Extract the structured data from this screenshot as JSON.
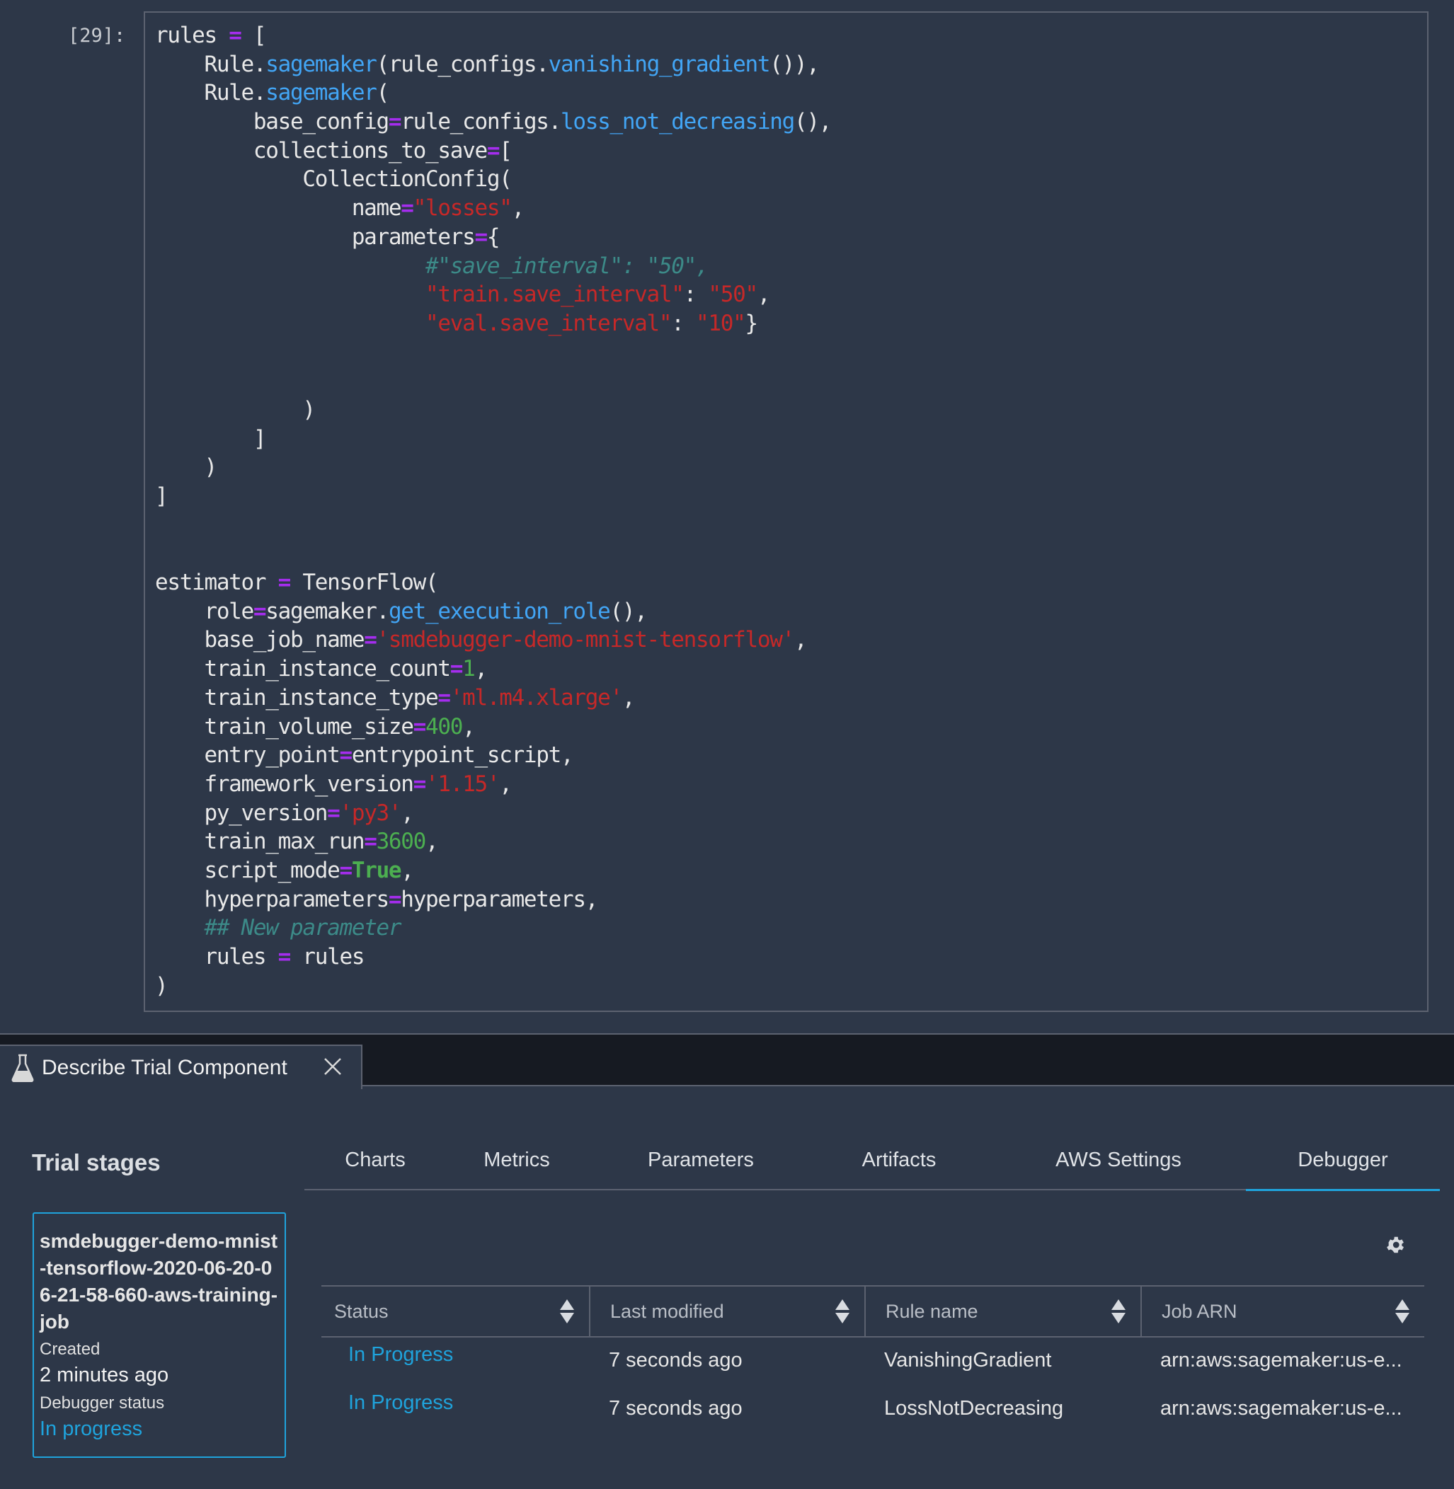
{
  "notebook": {
    "prompt": "[29]:",
    "code_lines": [
      [
        [
          "rules ",
          ""
        ],
        [
          "=",
          "op"
        ],
        [
          " [",
          ""
        ]
      ],
      [
        [
          "    Rule.",
          ""
        ],
        [
          "sagemaker",
          "fn"
        ],
        [
          "(rule_configs.",
          ""
        ],
        [
          "vanishing_gradient",
          "fn"
        ],
        [
          "()),",
          ""
        ]
      ],
      [
        [
          "    Rule.",
          ""
        ],
        [
          "sagemaker",
          "fn"
        ],
        [
          "(",
          ""
        ]
      ],
      [
        [
          "        base_config",
          ""
        ],
        [
          "=",
          "op"
        ],
        [
          "rule_configs.",
          ""
        ],
        [
          "loss_not_decreasing",
          "fn"
        ],
        [
          "(),",
          ""
        ]
      ],
      [
        [
          "        collections_to_save",
          ""
        ],
        [
          "=",
          "op"
        ],
        [
          "[",
          ""
        ]
      ],
      [
        [
          "            CollectionConfig(",
          ""
        ]
      ],
      [
        [
          "                name",
          ""
        ],
        [
          "=",
          "op"
        ],
        [
          "\"losses\"",
          "st"
        ],
        [
          ",",
          ""
        ]
      ],
      [
        [
          "                parameters",
          ""
        ],
        [
          "=",
          "op"
        ],
        [
          "{",
          ""
        ]
      ],
      [
        [
          "                      #\"save_interval\": \"50\",",
          "cm"
        ]
      ],
      [
        [
          "                      ",
          ""
        ],
        [
          "\"train.save_interval\"",
          "st"
        ],
        [
          ": ",
          ""
        ],
        [
          "\"50\"",
          "st"
        ],
        [
          ",",
          ""
        ]
      ],
      [
        [
          "                      ",
          ""
        ],
        [
          "\"eval.save_interval\"",
          "st"
        ],
        [
          ": ",
          ""
        ],
        [
          "\"10\"",
          "st"
        ],
        [
          "}",
          ""
        ]
      ],
      [
        [
          "",
          ""
        ]
      ],
      [
        [
          "",
          ""
        ]
      ],
      [
        [
          "            )",
          ""
        ]
      ],
      [
        [
          "        ]",
          ""
        ]
      ],
      [
        [
          "    )",
          ""
        ]
      ],
      [
        [
          "]",
          ""
        ]
      ],
      [
        [
          "",
          ""
        ]
      ],
      [
        [
          "",
          ""
        ]
      ],
      [
        [
          "estimator ",
          ""
        ],
        [
          "=",
          "op"
        ],
        [
          " TensorFlow(",
          ""
        ]
      ],
      [
        [
          "    role",
          ""
        ],
        [
          "=",
          "op"
        ],
        [
          "sagemaker.",
          ""
        ],
        [
          "get_execution_role",
          "fn"
        ],
        [
          "(),",
          ""
        ]
      ],
      [
        [
          "    base_job_name",
          ""
        ],
        [
          "=",
          "op"
        ],
        [
          "'smdebugger-demo-mnist-tensorflow'",
          "st"
        ],
        [
          ",",
          ""
        ]
      ],
      [
        [
          "    train_instance_count",
          ""
        ],
        [
          "=",
          "op"
        ],
        [
          "1",
          "nm"
        ],
        [
          ",",
          ""
        ]
      ],
      [
        [
          "    train_instance_type",
          ""
        ],
        [
          "=",
          "op"
        ],
        [
          "'ml.m4.xlarge'",
          "st"
        ],
        [
          ",",
          ""
        ]
      ],
      [
        [
          "    train_volume_size",
          ""
        ],
        [
          "=",
          "op"
        ],
        [
          "400",
          "nm"
        ],
        [
          ",",
          ""
        ]
      ],
      [
        [
          "    entry_point",
          ""
        ],
        [
          "=",
          "op"
        ],
        [
          "entrypoint_script,",
          ""
        ]
      ],
      [
        [
          "    framework_version",
          ""
        ],
        [
          "=",
          "op"
        ],
        [
          "'1.15'",
          "st"
        ],
        [
          ",",
          ""
        ]
      ],
      [
        [
          "    py_version",
          ""
        ],
        [
          "=",
          "op"
        ],
        [
          "'py3'",
          "st"
        ],
        [
          ",",
          ""
        ]
      ],
      [
        [
          "    train_max_run",
          ""
        ],
        [
          "=",
          "op"
        ],
        [
          "3600",
          "nm"
        ],
        [
          ",",
          ""
        ]
      ],
      [
        [
          "    script_mode",
          ""
        ],
        [
          "=",
          "op"
        ],
        [
          "True",
          "kw"
        ],
        [
          ",",
          ""
        ]
      ],
      [
        [
          "    hyperparameters",
          ""
        ],
        [
          "=",
          "op"
        ],
        [
          "hyperparameters,",
          ""
        ]
      ],
      [
        [
          "    ",
          ""
        ],
        [
          "## New parameter",
          "cm"
        ]
      ],
      [
        [
          "    rules ",
          ""
        ],
        [
          "=",
          "op"
        ],
        [
          " rules",
          ""
        ]
      ],
      [
        [
          ")",
          ""
        ]
      ]
    ]
  },
  "panel": {
    "tab_title": "Describe Trial Component",
    "tab_icon": "flask-icon",
    "close_icon": "close-icon",
    "trial_stages_title": "Trial stages",
    "stage": {
      "name": "smdebugger-demo-mnist-tensorflow-2020-06-20-06-21-58-660-aws-training-job",
      "created_label": "Created",
      "created_value": "2 minutes ago",
      "debugger_status_label": "Debugger status",
      "debugger_status_value": "In progress"
    },
    "tabs": [
      {
        "label": "Charts",
        "active": false
      },
      {
        "label": "Metrics",
        "active": false
      },
      {
        "label": "Parameters",
        "active": false
      },
      {
        "label": "Artifacts",
        "active": false
      },
      {
        "label": "AWS Settings",
        "active": false
      },
      {
        "label": "Debugger",
        "active": true
      }
    ],
    "settings_icon": "gear-icon",
    "table": {
      "columns": [
        "Status",
        "Last modified",
        "Rule name",
        "Job ARN"
      ],
      "rows": [
        {
          "status": "In Progress",
          "last_modified": "7 seconds ago",
          "rule_name": "VanishingGradient",
          "job_arn": "arn:aws:sagemaker:us-e..."
        },
        {
          "status": "In Progress",
          "last_modified": "7 seconds ago",
          "rule_name": "LossNotDecreasing",
          "job_arn": "arn:aws:sagemaker:us-e..."
        }
      ]
    },
    "colors": {
      "accent": "#1fa3dc",
      "background": "#2d3748",
      "tabbar": "#161a22"
    }
  }
}
